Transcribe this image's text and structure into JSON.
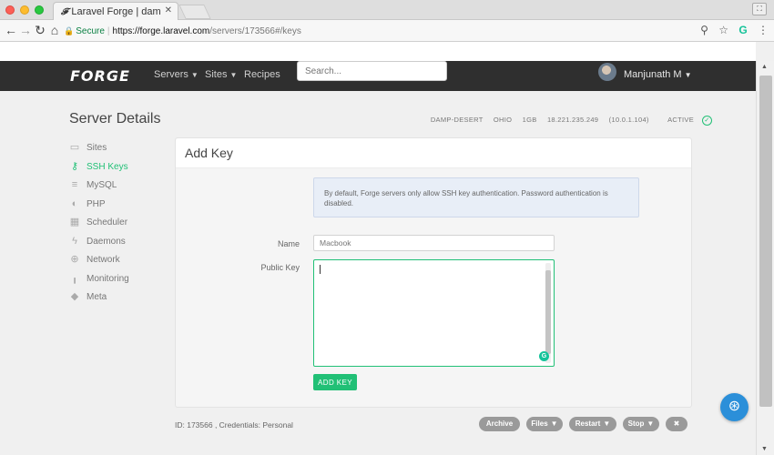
{
  "browser": {
    "tab_title": "Laravel Forge | dam",
    "tab_icon": "forge-favicon",
    "url_secure_label": "Secure",
    "url_host": "https://forge.laravel.com",
    "url_path": "/servers/173566#/keys"
  },
  "nav": {
    "logo": "FORGE",
    "links": [
      "Servers",
      "Sites",
      "Recipes"
    ],
    "search_placeholder": "Search...",
    "user_name": "Manjunath M"
  },
  "server": {
    "title": "Server Details",
    "name": "DAMP-DESERT",
    "region": "OHIO",
    "size": "1GB",
    "ip": "18.221.235.249",
    "private_ip": "(10.0.1.104)",
    "status": "ACTIVE"
  },
  "sidebar": {
    "items": [
      {
        "label": "Sites",
        "icon": "browser-window-icon"
      },
      {
        "label": "SSH Keys",
        "icon": "key-icon"
      },
      {
        "label": "MySQL",
        "icon": "database-icon"
      },
      {
        "label": "PHP",
        "icon": "php-icon"
      },
      {
        "label": "Scheduler",
        "icon": "calendar-icon"
      },
      {
        "label": "Daemons",
        "icon": "bolt-icon"
      },
      {
        "label": "Network",
        "icon": "globe-icon"
      },
      {
        "label": "Monitoring",
        "icon": "bar-chart-icon"
      },
      {
        "label": "Meta",
        "icon": "tag-icon"
      }
    ],
    "active_index": 1
  },
  "panel": {
    "title": "Add Key",
    "info": "By default, Forge servers only allow SSH key authentication. Password authentication is disabled.",
    "name_label": "Name",
    "name_placeholder": "Macbook",
    "key_label": "Public Key",
    "submit": "ADD KEY"
  },
  "footer": {
    "id_text": "ID: 173566 , Credentials: Personal",
    "buttons": [
      "Archive",
      "Files",
      "Restart",
      "Stop"
    ]
  },
  "colors": {
    "accent": "#21c076",
    "nav_bg": "#2f2f2f",
    "info_bg": "#e8eef7",
    "help_button": "#2b8fd9"
  }
}
